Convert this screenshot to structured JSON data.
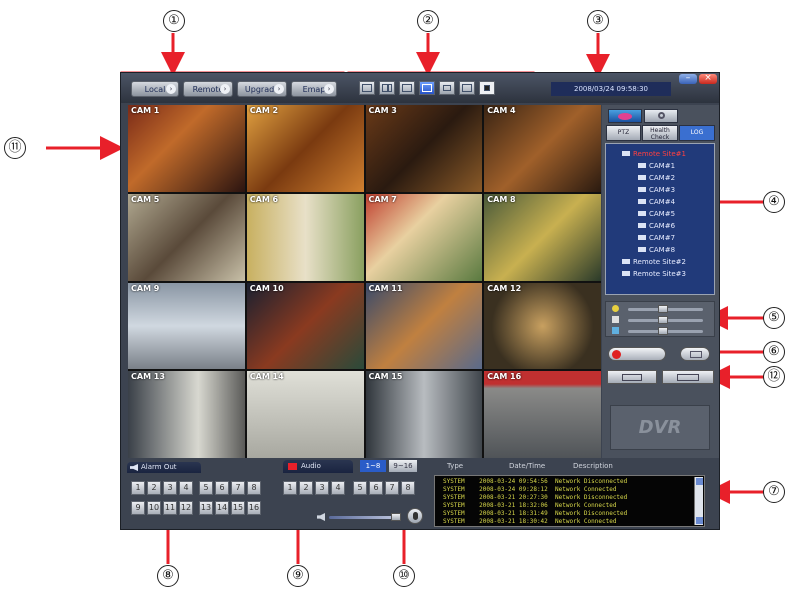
{
  "callouts": [
    "①",
    "②",
    "③",
    "④",
    "⑤",
    "⑥",
    "⑦",
    "⑧",
    "⑨",
    "⑩",
    "⑪",
    "⑫"
  ],
  "toolbar": {
    "buttons": [
      "Local",
      "Remote",
      "Upgrade",
      "Emap"
    ]
  },
  "datetime": "2008/03/24 09:58:30",
  "cameras": [
    "CAM 1",
    "CAM 2",
    "CAM 3",
    "CAM 4",
    "CAM 5",
    "CAM 6",
    "CAM 7",
    "CAM 8",
    "CAM 9",
    "CAM 10",
    "CAM 11",
    "CAM 12",
    "CAM 13",
    "CAM 14",
    "CAM 15",
    "CAM 16"
  ],
  "right_panel": {
    "tabs": [
      "PTZ",
      "Health Check",
      "LOG"
    ],
    "tree": {
      "root": "Remote Site#1",
      "cams": [
        "CAM#1",
        "CAM#2",
        "CAM#3",
        "CAM#4",
        "CAM#5",
        "CAM#6",
        "CAM#7",
        "CAM#8"
      ],
      "sites": [
        "Remote Site#2",
        "Remote Site#3"
      ]
    },
    "logo": "DVR"
  },
  "alarm_out": {
    "title": "Alarm Out",
    "buttons_row1": [
      "1",
      "2",
      "3",
      "4",
      "5",
      "6",
      "7",
      "8"
    ],
    "buttons_row2": [
      "9",
      "10",
      "11",
      "12",
      "13",
      "14",
      "15",
      "16"
    ]
  },
  "audio": {
    "title": "Audio",
    "page_a": "1~8",
    "page_b": "9~16",
    "buttons": [
      "1",
      "2",
      "3",
      "4",
      "5",
      "6",
      "7",
      "8"
    ]
  },
  "events": {
    "headers": {
      "type": "Type",
      "time": "Date/Time",
      "desc": "Description"
    },
    "rows": [
      {
        "type": "SYSTEM",
        "time": "2008-03-24 09:54:56",
        "desc": "Network Disconnected"
      },
      {
        "type": "SYSTEM",
        "time": "2008-03-24 09:28:12",
        "desc": "Network Connected"
      },
      {
        "type": "SYSTEM",
        "time": "2008-03-21 20:27:30",
        "desc": "Network Disconnected"
      },
      {
        "type": "SYSTEM",
        "time": "2008-03-21 18:32:06",
        "desc": "Network Connected"
      },
      {
        "type": "SYSTEM",
        "time": "2008-03-21 18:31:49",
        "desc": "Network Disconnected"
      },
      {
        "type": "SYSTEM",
        "time": "2008-03-21 18:30:42",
        "desc": "Network Connected"
      }
    ]
  },
  "colors": {
    "accent_red": "#e8202a",
    "tree_bg": "#213a7a",
    "log_tab": "#3a6fd0",
    "event_text": "#d8d84a"
  }
}
